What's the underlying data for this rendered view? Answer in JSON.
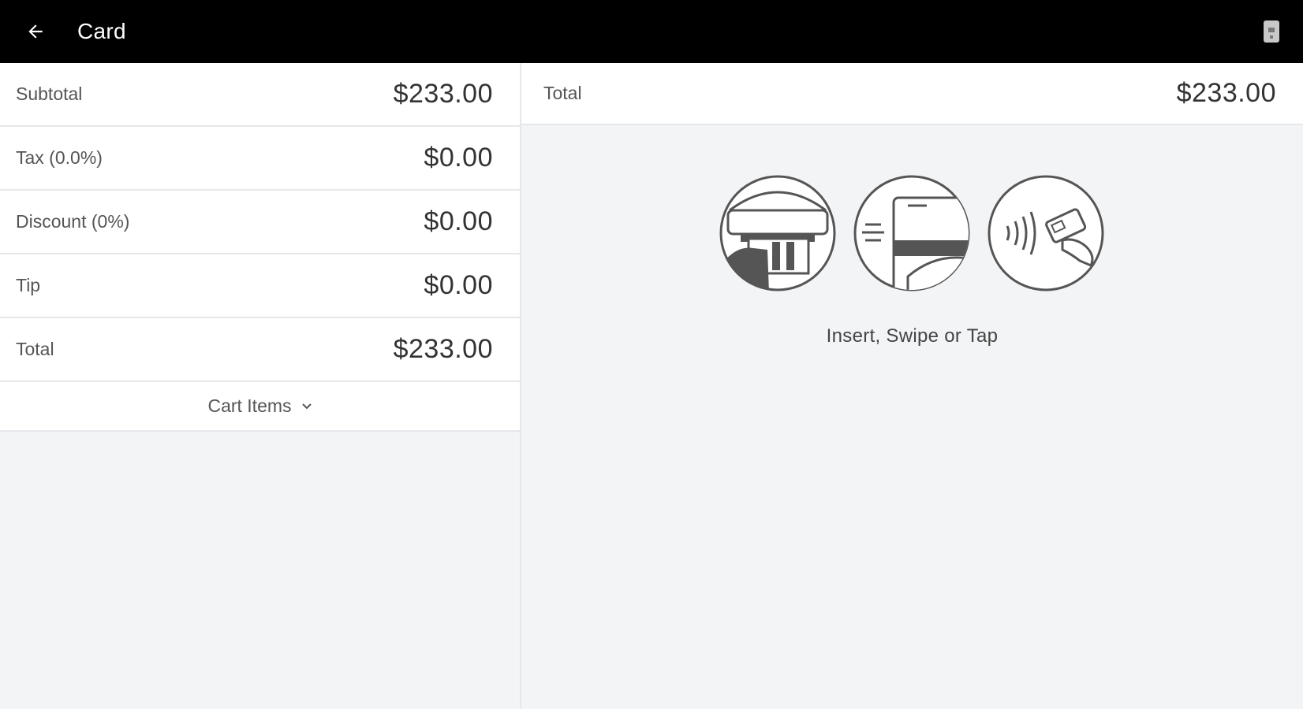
{
  "header": {
    "title": "Card",
    "back_icon": "arrow-left-icon",
    "device_icon": "card-reader-icon"
  },
  "summary": {
    "rows": [
      {
        "label": "Subtotal",
        "value": "$233.00"
      },
      {
        "label": "Tax (0.0%)",
        "value": "$0.00"
      },
      {
        "label": "Discount (0%)",
        "value": "$0.00"
      },
      {
        "label": "Tip",
        "value": "$0.00"
      },
      {
        "label": "Total",
        "value": "$233.00"
      }
    ],
    "cart_items_label": "Cart Items"
  },
  "payment": {
    "total_label": "Total",
    "total_value": "$233.00",
    "methods": [
      "insert-card-icon",
      "swipe-card-icon",
      "tap-card-icon"
    ],
    "prompt": "Insert, Swipe or Tap"
  },
  "colors": {
    "header_bg": "#000000",
    "panel_bg": "#f3f4f6",
    "row_bg": "#ffffff"
  }
}
